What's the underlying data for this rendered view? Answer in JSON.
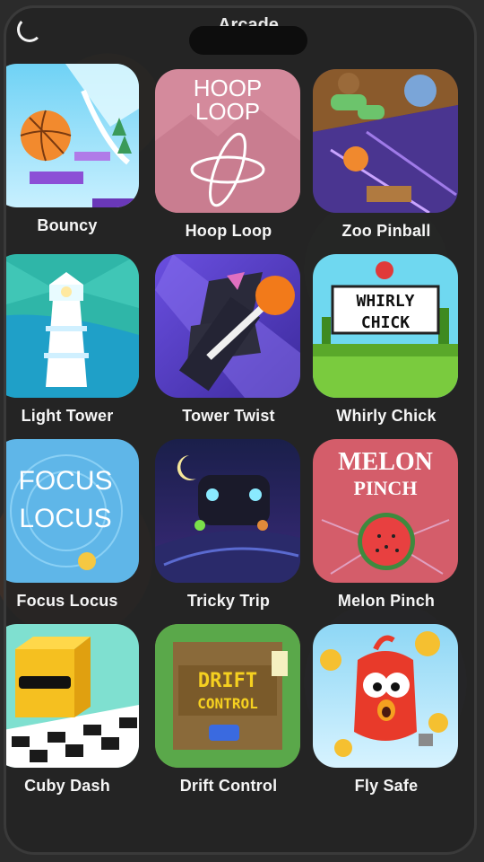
{
  "header": {
    "title": "Arcade"
  },
  "games": [
    {
      "name": "Bouncy"
    },
    {
      "name": "Hoop Loop",
      "art_text": "HOOP LOOP"
    },
    {
      "name": "Zoo Pinball"
    },
    {
      "name": "Light Tower"
    },
    {
      "name": "Tower Twist"
    },
    {
      "name": "Whirly Chick",
      "art_text": "WHIRLY CHICK"
    },
    {
      "name": "Focus Locus",
      "art_text": "FOCUS LOCUS"
    },
    {
      "name": "Tricky Trip"
    },
    {
      "name": "Melon Pinch",
      "art_text": "MELON PINCH"
    },
    {
      "name": "Cuby Dash"
    },
    {
      "name": "Drift Control",
      "art_text": "DRIFT CONTROL"
    },
    {
      "name": "Fly Safe"
    }
  ],
  "colors": {
    "background": "#2b2b2b",
    "label": "#f5f5f5",
    "hoop_loop_bg": "#d48a9c",
    "focus_locus_bg": "#5fb6e8",
    "melon_pinch_bg": "#d45d6a"
  }
}
